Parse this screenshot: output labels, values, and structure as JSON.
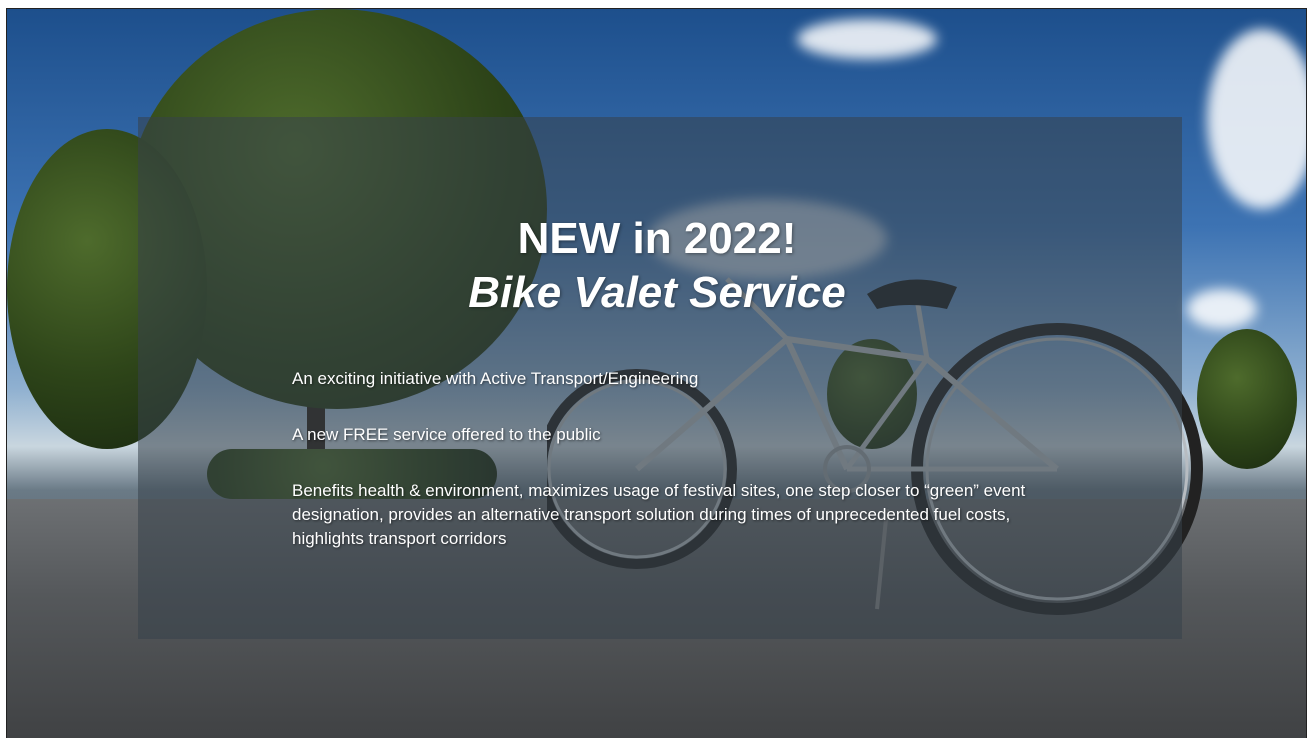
{
  "slide": {
    "title_line1": "NEW in 2022!",
    "title_line2": "Bike Valet Service",
    "bullets": [
      "An exciting initiative with Active Transport/Engineering",
      "A new FREE service offered to the public",
      "Benefits health & environment, maximizes usage of festival sites, one step closer to “green” event designation, provides an alternative transport solution during times of unprecedented fuel costs, highlights transport corridors"
    ]
  },
  "colors": {
    "text": "#ffffff",
    "overlay": "rgba(55,65,75,0.55)",
    "sky": "#3d73b3",
    "road": "#55585b"
  }
}
